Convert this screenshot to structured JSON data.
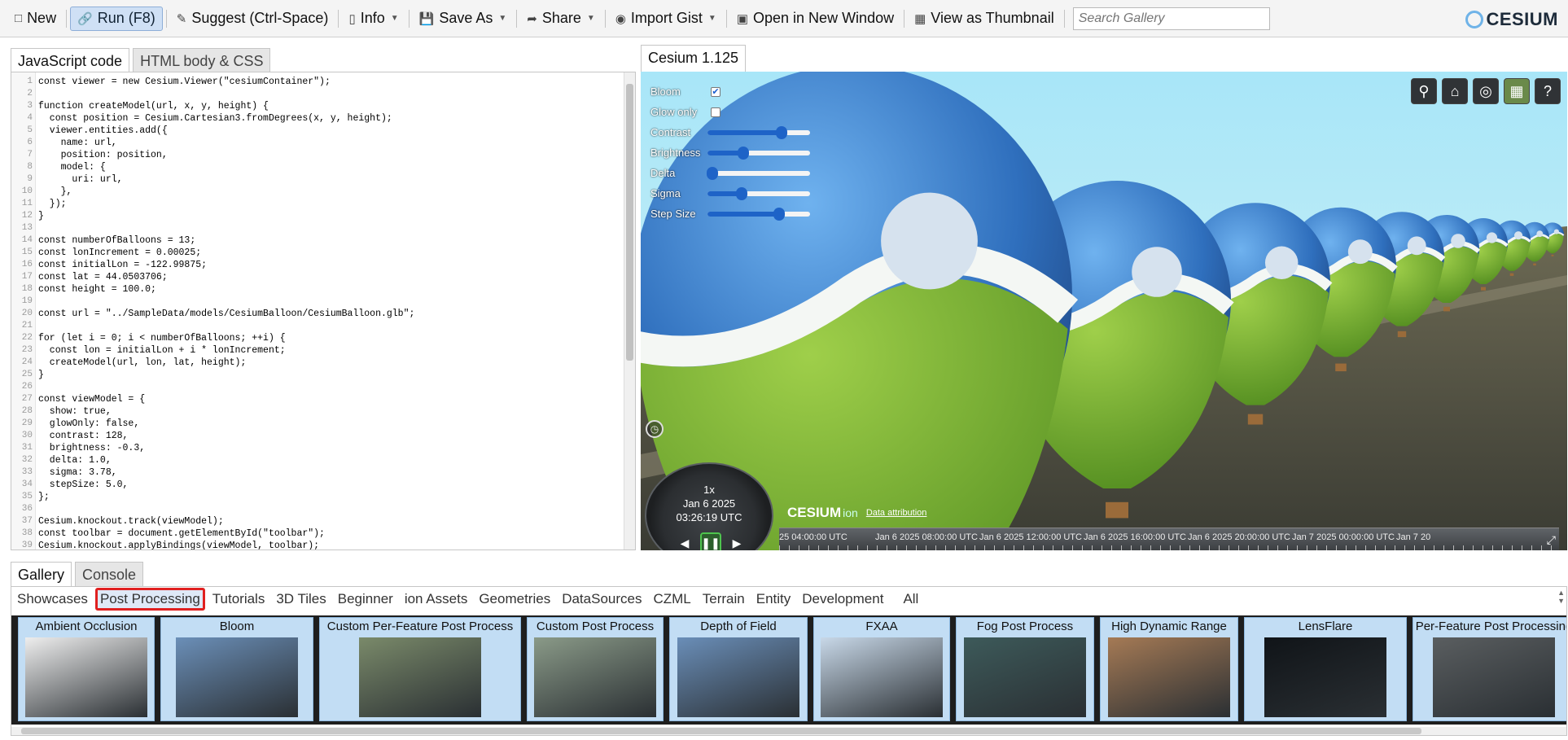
{
  "toolbar": {
    "new": "New",
    "run": "Run (F8)",
    "suggest": "Suggest (Ctrl-Space)",
    "info": "Info",
    "save_as": "Save As",
    "share": "Share",
    "import_gist": "Import Gist",
    "open_new_window": "Open in New Window",
    "view_thumbnail": "View as Thumbnail",
    "search_placeholder": "Search Gallery",
    "logo": "CESIUM"
  },
  "editor": {
    "tabs": [
      "JavaScript code",
      "HTML body & CSS"
    ],
    "lines": [
      "const viewer = new Cesium.Viewer(\"cesiumContainer\");",
      "",
      "function createModel(url, x, y, height) {",
      "  const position = Cesium.Cartesian3.fromDegrees(x, y, height);",
      "  viewer.entities.add({",
      "    name: url,",
      "    position: position,",
      "    model: {",
      "      uri: url,",
      "    },",
      "  });",
      "}",
      "",
      "const numberOfBalloons = 13;",
      "const lonIncrement = 0.00025;",
      "const initialLon = -122.99875;",
      "const lat = 44.0503706;",
      "const height = 100.0;",
      "",
      "const url = \"../SampleData/models/CesiumBalloon/CesiumBalloon.glb\";",
      "",
      "for (let i = 0; i < numberOfBalloons; ++i) {",
      "  const lon = initialLon + i * lonIncrement;",
      "  createModel(url, lon, lat, height);",
      "}",
      "",
      "const viewModel = {",
      "  show: true,",
      "  glowOnly: false,",
      "  contrast: 128,",
      "  brightness: -0.3,",
      "  delta: 1.0,",
      "  sigma: 3.78,",
      "  stepSize: 5.0,",
      "};",
      "",
      "Cesium.knockout.track(viewModel);",
      "const toolbar = document.getElementById(\"toolbar\");",
      "Cesium.knockout.applyBindings(viewModel, toolbar);"
    ]
  },
  "viewer": {
    "tab": "Cesium 1.125",
    "controls": {
      "bloom": {
        "label": "Bloom",
        "checked": true
      },
      "glow_only": {
        "label": "Glow only",
        "checked": false
      },
      "sliders": [
        {
          "label": "Contrast",
          "value": 0.72
        },
        {
          "label": "Brightness",
          "value": 0.35
        },
        {
          "label": "Delta",
          "value": 0.05
        },
        {
          "label": "Sigma",
          "value": 0.33
        },
        {
          "label": "Step Size",
          "value": 0.7
        }
      ]
    },
    "buttons": [
      "search-icon",
      "home-icon",
      "globe-icon",
      "layers-icon",
      "help-icon"
    ],
    "animation": {
      "speed": "1x",
      "date": "Jan 6 2025",
      "time": "03:26:19 UTC"
    },
    "credit": {
      "logo": "CESIUM",
      "ion": "ion",
      "attribution": "Data attribution"
    },
    "timeline": [
      "25 04:00:00 UTC",
      "Jan 6 2025 08:00:00 UTC",
      "Jan 6 2025 12:00:00 UTC",
      "Jan 6 2025 16:00:00 UTC",
      "Jan 6 2025 20:00:00 UTC",
      "Jan 7 2025 00:00:00 UTC",
      "Jan 7 20"
    ]
  },
  "bottom": {
    "tabs": [
      "Gallery",
      "Console"
    ],
    "categories": [
      "Showcases",
      "Post Processing",
      "Tutorials",
      "3D Tiles",
      "Beginner",
      "ion Assets",
      "Geometries",
      "DataSources",
      "CZML",
      "Terrain",
      "Entity",
      "Development",
      "All"
    ],
    "selected_category": "Post Processing",
    "thumbnails": [
      "Ambient Occlusion",
      "Bloom",
      "Custom Per-Feature Post Process",
      "Custom Post Process",
      "Depth of Field",
      "FXAA",
      "Fog Post Process",
      "High Dynamic Range",
      "LensFlare",
      "Per-Feature Post Processing"
    ]
  }
}
